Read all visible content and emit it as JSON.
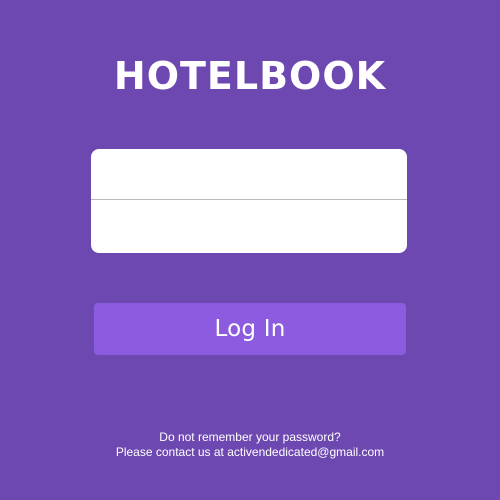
{
  "brand": {
    "logo_text": "HOTELBOOK"
  },
  "login_form": {
    "username_value": "",
    "username_placeholder": "",
    "password_value": "",
    "password_placeholder": ""
  },
  "actions": {
    "login_label": "Log In"
  },
  "help": {
    "line1": "Do not remember your password?",
    "line2": "Please contact us at activendedicated@gmail.com"
  },
  "colors": {
    "background": "#6e48b1",
    "button": "#8c5be0",
    "card": "#ffffff"
  }
}
